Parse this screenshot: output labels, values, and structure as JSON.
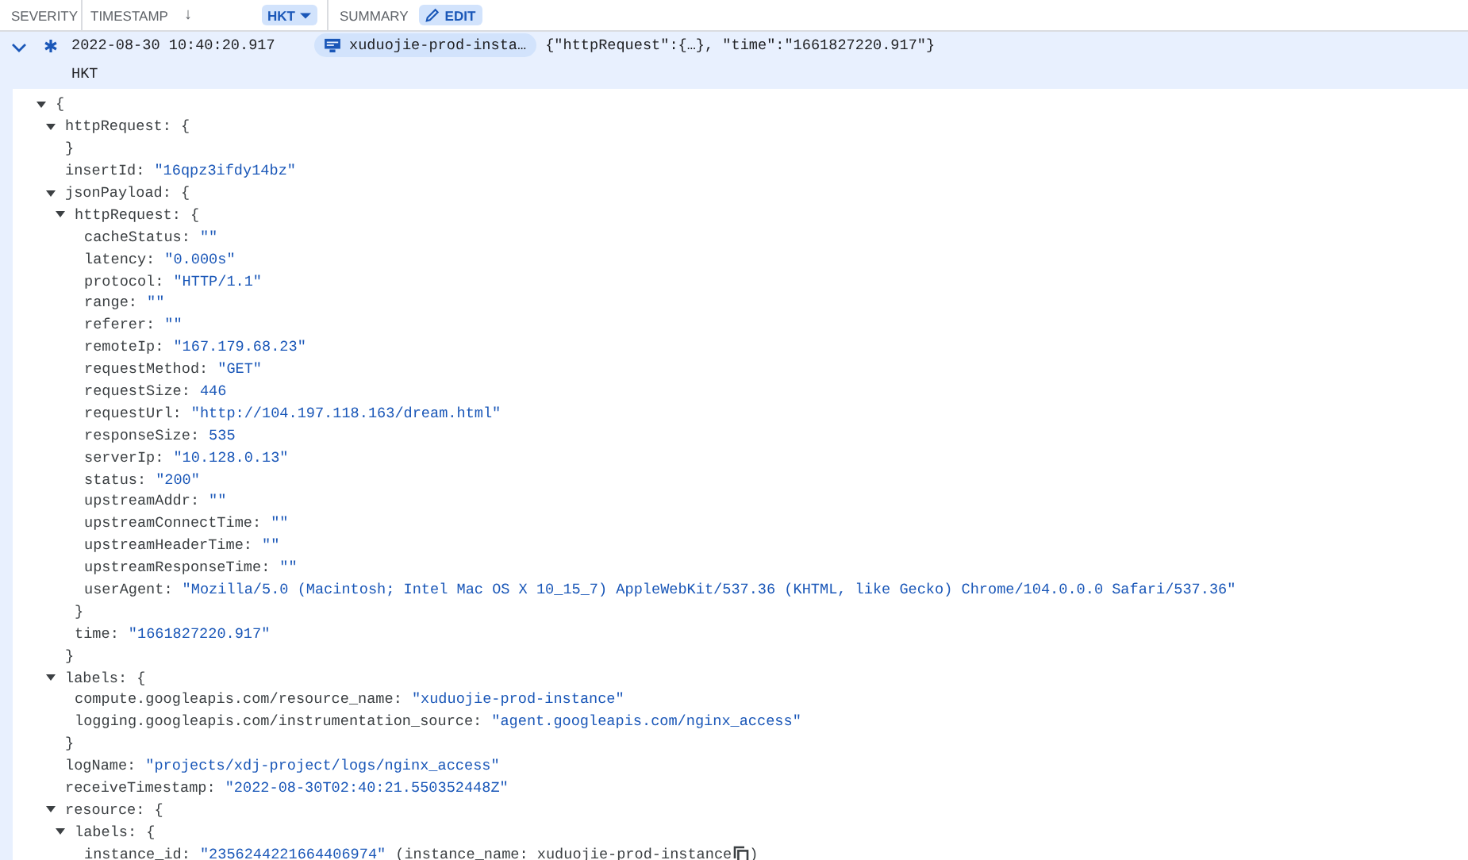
{
  "header": {
    "severity": "SEVERITY",
    "timestamp": "TIMESTAMP",
    "sort_arrow": "↓",
    "timezone": "HKT",
    "summary": "SUMMARY",
    "edit": "EDIT"
  },
  "entry": {
    "expanded": true,
    "timestamp": "2022-08-30 10:40:20.917",
    "timezone": "HKT",
    "resource": "xuduojie-prod-insta…",
    "summary": "{\"httpRequest\":{…}, \"time\":\"1661827220.917\"}"
  },
  "payload": {
    "open": "{",
    "expanded": true,
    "children": [
      {
        "key": "httpRequest:",
        "open": "{",
        "close": "}",
        "expanded": true
      },
      {
        "key": "insertId:",
        "value": "\"16qpz3ifdy14bz\""
      },
      {
        "key": "jsonPayload:",
        "open": "{",
        "close": "}",
        "expanded": true,
        "children": [
          {
            "key": "httpRequest:",
            "open": "{",
            "close": "}",
            "expanded": true,
            "children": [
              {
                "key": "cacheStatus:",
                "value": "\"\""
              },
              {
                "key": "latency:",
                "value": "\"0.000s\""
              },
              {
                "key": "protocol:",
                "value": "\"HTTP/1.1\""
              },
              {
                "key": "range:",
                "value": "\"\""
              },
              {
                "key": "referer:",
                "value": "\"\""
              },
              {
                "key": "remoteIp:",
                "value": "\"167.179.68.23\""
              },
              {
                "key": "requestMethod:",
                "value": "\"GET\""
              },
              {
                "key": "requestSize:",
                "value": "446"
              },
              {
                "key": "requestUrl:",
                "value": "\"http://104.197.118.163/dream.html\""
              },
              {
                "key": "responseSize:",
                "value": "535"
              },
              {
                "key": "serverIp:",
                "value": "\"10.128.0.13\""
              },
              {
                "key": "status:",
                "value": "\"200\""
              },
              {
                "key": "upstreamAddr:",
                "value": "\"\""
              },
              {
                "key": "upstreamConnectTime:",
                "value": "\"\""
              },
              {
                "key": "upstreamHeaderTime:",
                "value": "\"\""
              },
              {
                "key": "upstreamResponseTime:",
                "value": "\"\""
              },
              {
                "key": "userAgent:",
                "value": "\"Mozilla/5.0 (Macintosh; Intel Mac OS X 10_15_7) AppleWebKit/537.36 (KHTML, like Gecko) Chrome/104.0.0.0 Safari/537.36\""
              }
            ]
          },
          {
            "key": "time:",
            "value": "\"1661827220.917\""
          }
        ]
      },
      {
        "key": "labels:",
        "open": "{",
        "close": "}",
        "expanded": true,
        "children": [
          {
            "key": "compute.googleapis.com/resource_name:",
            "value": "\"xuduojie-prod-instance\""
          },
          {
            "key": "logging.googleapis.com/instrumentation_source:",
            "value": "\"agent.googleapis.com/nginx_access\""
          }
        ]
      },
      {
        "key": "logName:",
        "value": "\"projects/xdj-project/logs/nginx_access\""
      },
      {
        "key": "receiveTimestamp:",
        "value": "\"2022-08-30T02:40:21.550352448Z\""
      },
      {
        "key": "resource:",
        "open": "{",
        "expanded": true,
        "children": [
          {
            "key": "labels:",
            "open": "{",
            "expanded": true,
            "children": [
              {
                "key": "instance_id:",
                "value": "\"2356244221664406974\"",
                "note": "(instance_name: xuduojie-prod-instance",
                "note_end": ")"
              }
            ]
          }
        ]
      }
    ]
  }
}
